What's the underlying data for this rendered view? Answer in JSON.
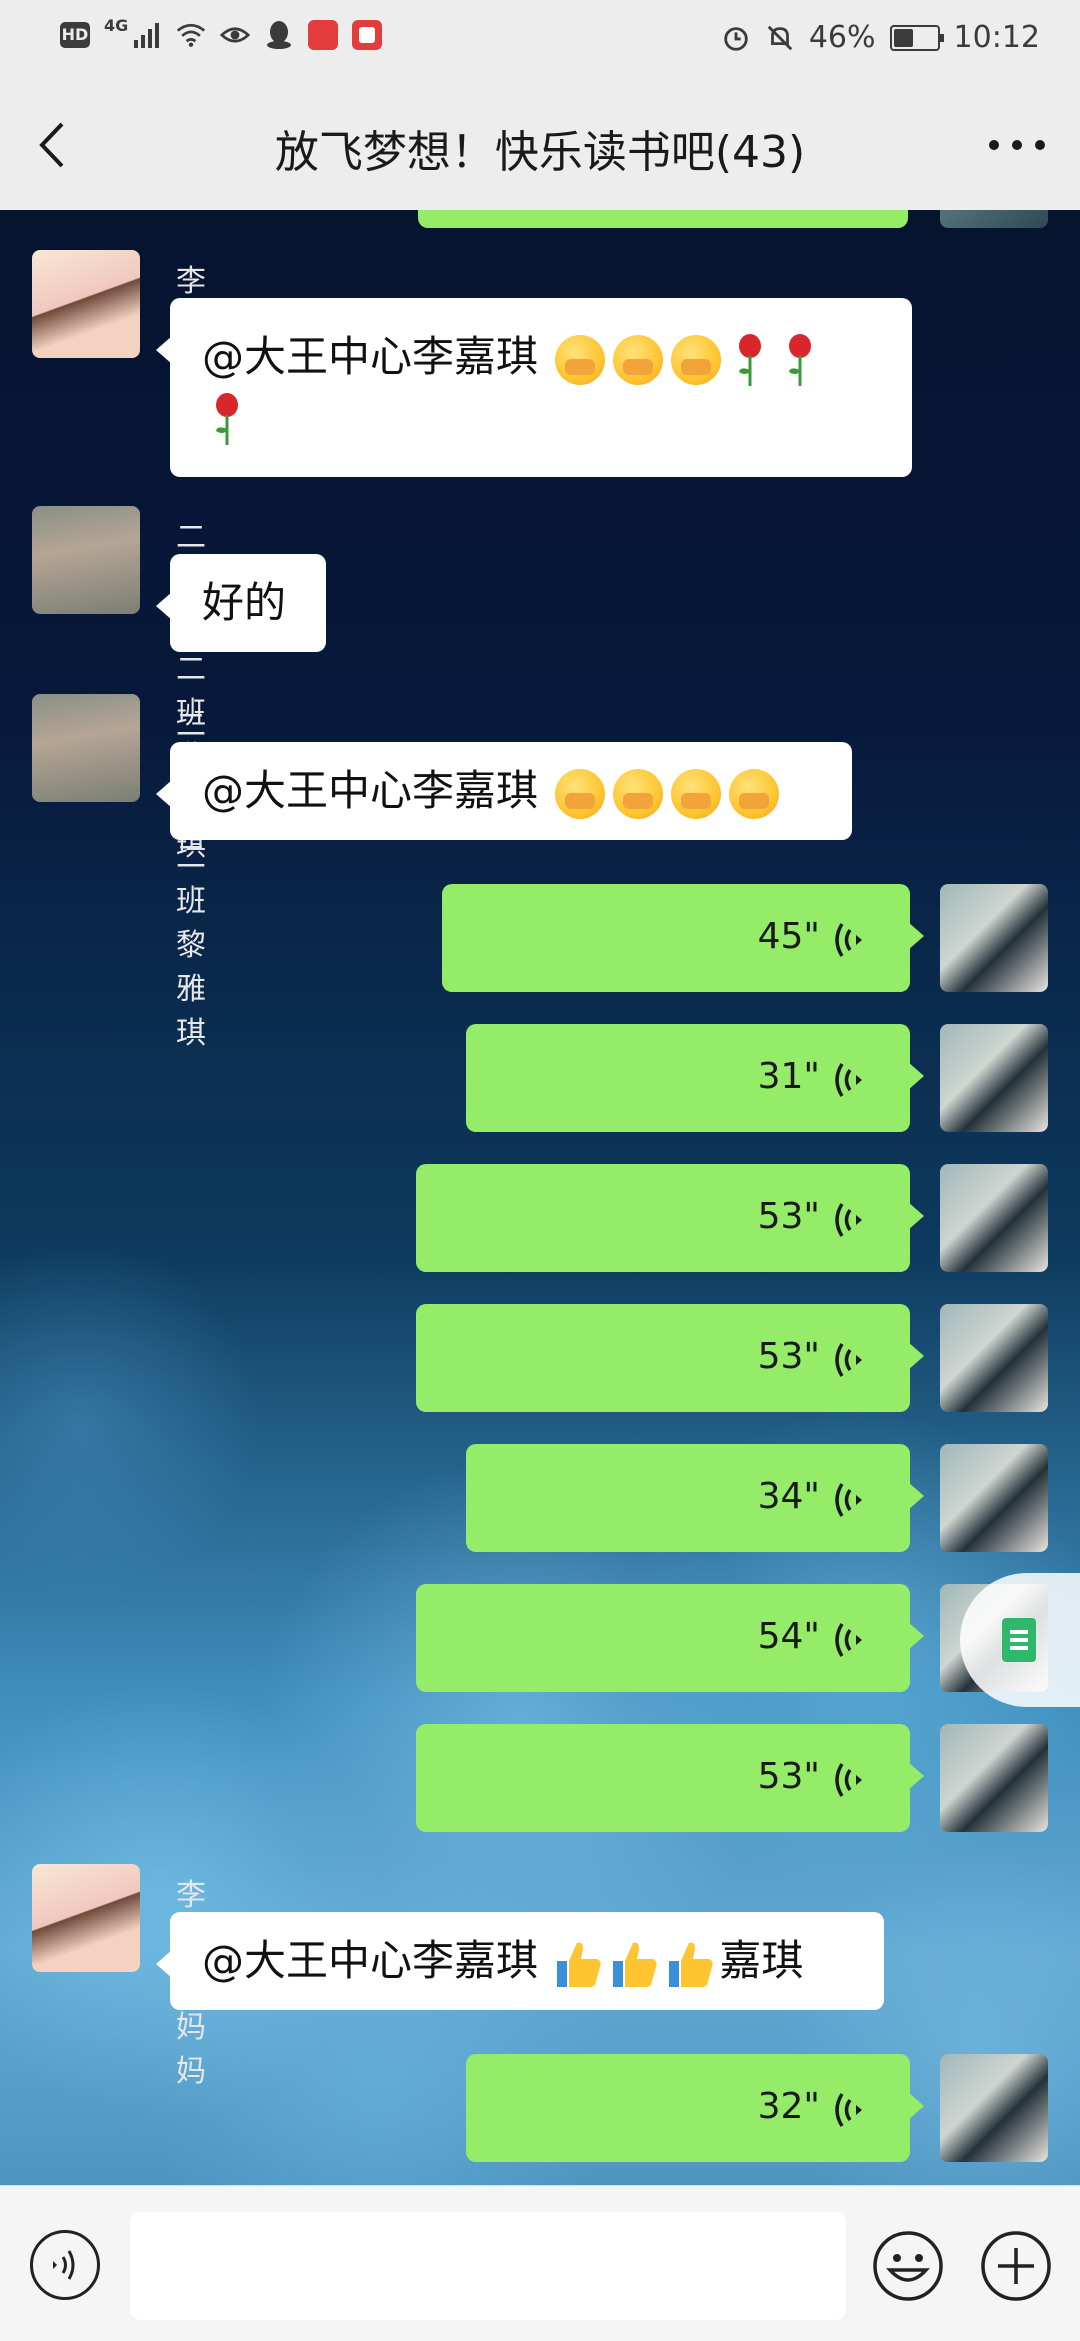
{
  "status_bar": {
    "hd": "HD",
    "network": "4G",
    "battery_percent": "46%",
    "battery_level": 0.46,
    "time": "10:12"
  },
  "header": {
    "title": "放飞梦想！快乐读书吧(43)",
    "back_icon": "chevron-left-icon",
    "more_icon": "more-dots-icon"
  },
  "messages": [
    {
      "type": "text",
      "direction": "incoming",
      "sender": "李美含妈妈",
      "text": "@大王中心李嘉琪 ",
      "emojis": [
        "hugging-face",
        "hugging-face",
        "hugging-face",
        "rose",
        "rose",
        "rose"
      ]
    },
    {
      "type": "text",
      "direction": "incoming",
      "sender": "二年级二班黎雅琪",
      "text": "好的"
    },
    {
      "type": "text",
      "direction": "incoming",
      "sender": "二年级二班黎雅琪",
      "text": "@大王中心李嘉琪 ",
      "emojis": [
        "hugging-face",
        "hugging-face",
        "hugging-face",
        "hugging-face"
      ]
    },
    {
      "type": "voice",
      "direction": "outgoing",
      "duration": "45\""
    },
    {
      "type": "voice",
      "direction": "outgoing",
      "duration": "31\""
    },
    {
      "type": "voice",
      "direction": "outgoing",
      "duration": "53\""
    },
    {
      "type": "voice",
      "direction": "outgoing",
      "duration": "53\""
    },
    {
      "type": "voice",
      "direction": "outgoing",
      "duration": "34\""
    },
    {
      "type": "voice",
      "direction": "outgoing",
      "duration": "54\""
    },
    {
      "type": "voice",
      "direction": "outgoing",
      "duration": "53\""
    },
    {
      "type": "text",
      "direction": "incoming",
      "sender": "李美含妈妈",
      "text": "@大王中心李嘉琪 ",
      "text_after": "嘉琪",
      "emojis": [
        "thumbs-up",
        "thumbs-up",
        "thumbs-up"
      ]
    },
    {
      "type": "voice",
      "direction": "outgoing",
      "duration": "32\""
    }
  ],
  "input_bar": {
    "voice_icon": "voice-mode-icon",
    "text_value": "",
    "emoji_icon": "emoji-icon",
    "plus_icon": "plus-icon"
  },
  "floating_button": {
    "icon": "document-icon"
  },
  "colors": {
    "header_bg": "#ededed",
    "bubble_out": "#95ec69",
    "bubble_in": "#ffffff",
    "doc_icon": "#2fb86c"
  }
}
